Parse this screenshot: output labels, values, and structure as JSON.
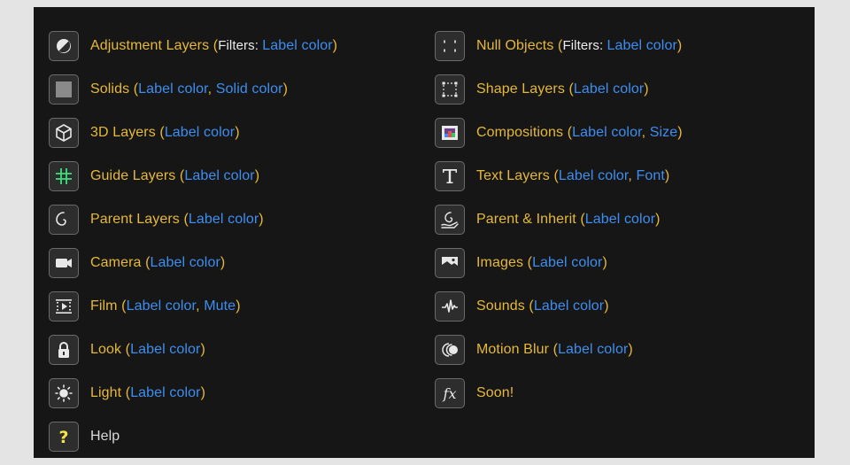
{
  "left": [
    {
      "name": "Adjustment Layers",
      "prefix": "Filters: ",
      "opts": [
        "Label color"
      ]
    },
    {
      "name": "Solids",
      "prefix": "",
      "opts": [
        "Label color",
        "Solid color"
      ]
    },
    {
      "name": "3D Layers",
      "prefix": "",
      "opts": [
        "Label color"
      ]
    },
    {
      "name": "Guide Layers",
      "prefix": "",
      "opts": [
        "Label color"
      ]
    },
    {
      "name": "Parent Layers",
      "prefix": "",
      "opts": [
        "Label color"
      ]
    },
    {
      "name": "Camera",
      "prefix": "",
      "opts": [
        "Label color"
      ]
    },
    {
      "name": "Film",
      "prefix": "",
      "opts": [
        "Label color",
        "Mute"
      ]
    },
    {
      "name": "Look",
      "prefix": "",
      "opts": [
        "Label color"
      ]
    },
    {
      "name": "Light",
      "prefix": "",
      "opts": [
        "Label color"
      ]
    }
  ],
  "right": [
    {
      "name": "Null Objects",
      "prefix": "Filters: ",
      "opts": [
        "Label color"
      ]
    },
    {
      "name": "Shape Layers",
      "prefix": "",
      "opts": [
        "Label color"
      ]
    },
    {
      "name": "Compositions",
      "prefix": "",
      "opts": [
        "Label color",
        "Size"
      ]
    },
    {
      "name": "Text Layers",
      "prefix": "",
      "opts": [
        "Label color",
        "Font"
      ]
    },
    {
      "name": "Parent & Inherit",
      "prefix": "",
      "opts": [
        "Label color"
      ]
    },
    {
      "name": "Images",
      "prefix": "",
      "opts": [
        "Label color"
      ]
    },
    {
      "name": "Sounds",
      "prefix": "",
      "opts": [
        "Label color"
      ]
    },
    {
      "name": "Motion Blur",
      "prefix": "",
      "opts": [
        "Label color"
      ]
    },
    {
      "name": "Soon!",
      "prefix": "",
      "opts": []
    }
  ],
  "help": {
    "label": "Help"
  },
  "icons": {
    "left": [
      "adjustment-icon",
      "solid-icon",
      "cube-icon",
      "grid-icon",
      "spiral-icon",
      "camera-icon",
      "film-icon",
      "lock-icon",
      "sun-icon"
    ],
    "right": [
      "null-icon",
      "shape-icon",
      "composition-icon",
      "text-icon",
      "parent-inherit-icon",
      "image-icon",
      "waveform-icon",
      "motion-blur-icon",
      "fx-icon"
    ],
    "help": "question-icon"
  },
  "colors": {
    "name": "#e6b93a",
    "option": "#3d8ef0",
    "prefix": "#ececec",
    "panel": "#161616",
    "icon_bg": "#2d2d2d",
    "help_glyph": "#f5e34a"
  }
}
